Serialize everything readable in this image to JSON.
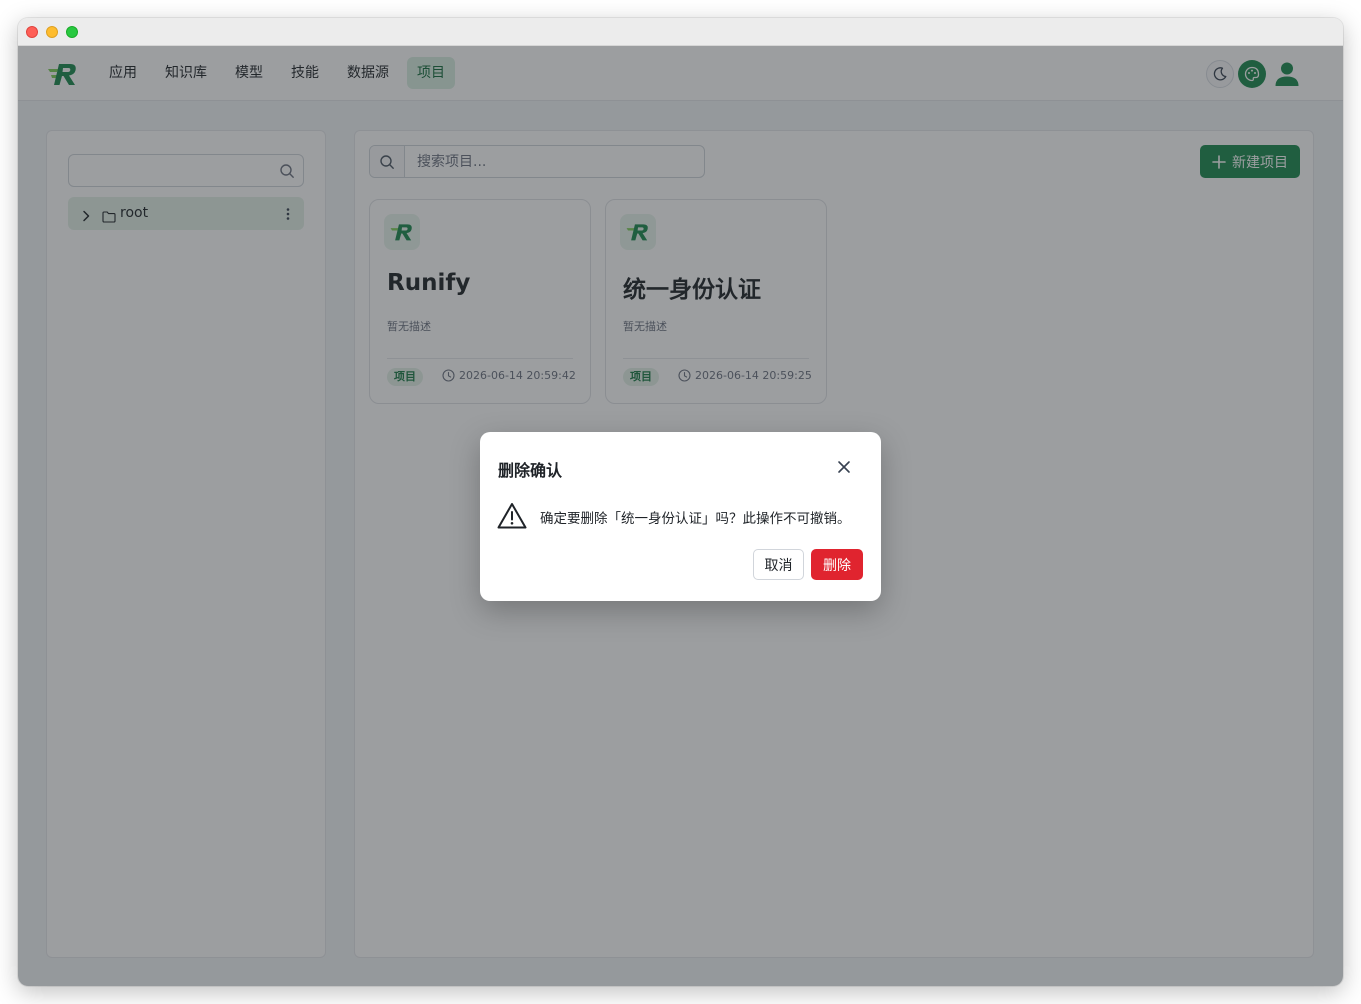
{
  "nav": {
    "items": [
      {
        "label": "应用"
      },
      {
        "label": "知识库"
      },
      {
        "label": "模型"
      },
      {
        "label": "技能"
      },
      {
        "label": "数据源"
      },
      {
        "label": "项目"
      }
    ],
    "active": "项目"
  },
  "tree": {
    "search_value": "",
    "root_label": "root"
  },
  "projects": {
    "search_placeholder": "搜索项目...",
    "new_button_label": "新建项目",
    "cards": [
      {
        "name": "Runify",
        "description": "暂无描述",
        "tag": "项目",
        "time": "2026-06-14 20:59:42"
      },
      {
        "name": "统一身份认证",
        "description": "暂无描述",
        "tag": "项目",
        "time": "2026-06-14 20:59:25"
      }
    ]
  },
  "dialog": {
    "title": "删除确认",
    "message": "确定要删除「统一身份认证」吗？此操作不可撤销。",
    "cancel_label": "取消",
    "confirm_label": "删除"
  },
  "colors": {
    "brand_green": "#1b8a4f",
    "danger_red": "#e0242f",
    "active_nav_bg": "#d9efe2"
  }
}
